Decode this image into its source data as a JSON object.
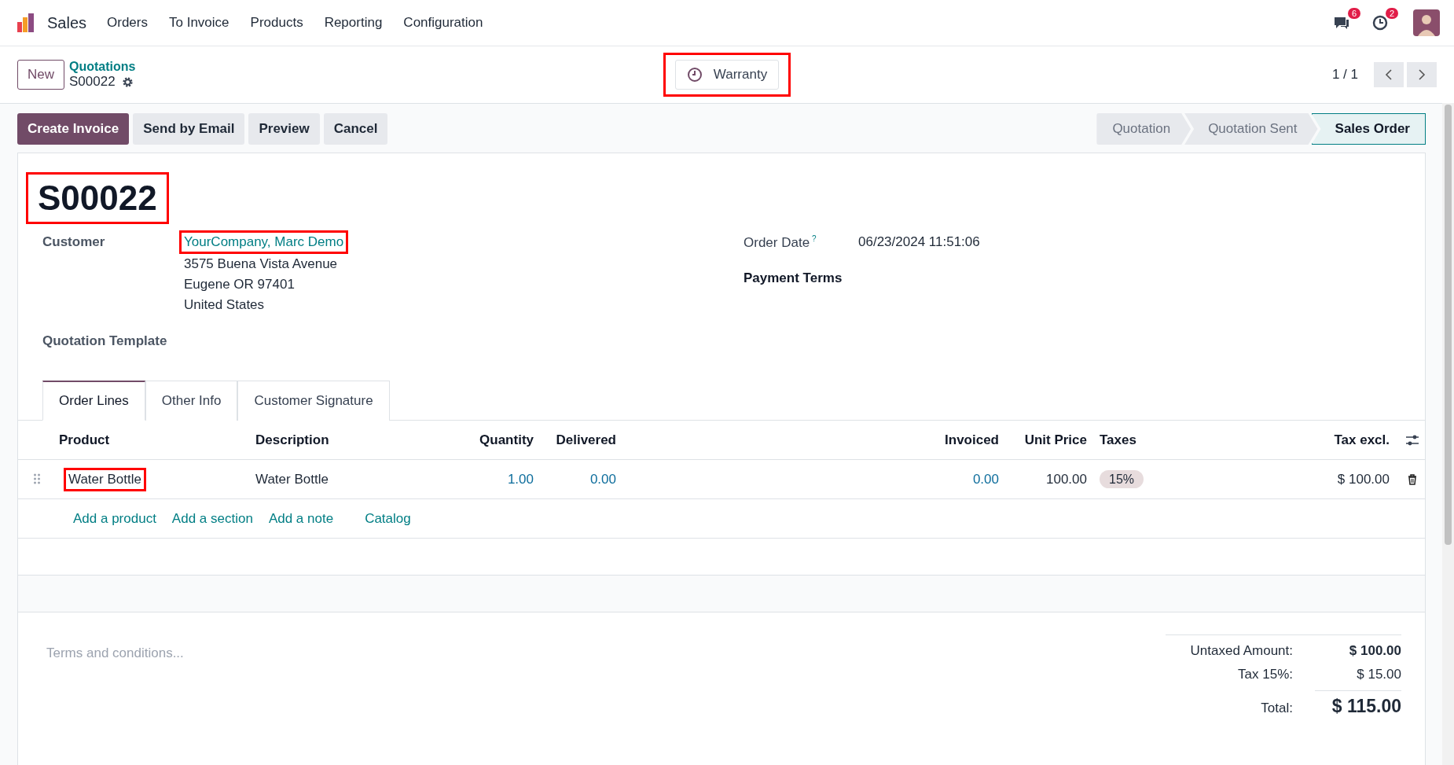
{
  "navbar": {
    "app": "Sales",
    "menu": [
      "Orders",
      "To Invoice",
      "Products",
      "Reporting",
      "Configuration"
    ],
    "messages_count": "6",
    "activities_count": "2"
  },
  "control_panel": {
    "new_button": "New",
    "breadcrumb": "Quotations",
    "record": "S00022",
    "smart_button": {
      "label": "Warranty",
      "highlighted": true
    },
    "pager": "1 / 1"
  },
  "actions": [
    {
      "label": "Create Invoice",
      "primary": true
    },
    {
      "label": "Send by Email",
      "primary": false
    },
    {
      "label": "Preview",
      "primary": false
    },
    {
      "label": "Cancel",
      "primary": false
    }
  ],
  "statusbar": [
    {
      "label": "Quotation",
      "selected": false
    },
    {
      "label": "Quotation Sent",
      "selected": false
    },
    {
      "label": "Sales Order",
      "selected": true
    }
  ],
  "title": {
    "text": "S00022",
    "highlighted": true
  },
  "fields_left": [
    {
      "label": "Customer",
      "value": "YourCompany, Marc Demo",
      "highlighted": true,
      "address": [
        "3575 Buena Vista Avenue",
        "Eugene OR 97401",
        "United States"
      ]
    },
    {
      "label": "Quotation Template"
    }
  ],
  "fields_right": [
    {
      "label": "Order Date",
      "help": "?",
      "value": "06/23/2024 11:51:06"
    },
    {
      "label": "Payment Terms"
    }
  ],
  "tabs": [
    {
      "label": "Order Lines",
      "selected": true
    },
    {
      "label": "Other Info",
      "selected": false
    },
    {
      "label": "Customer Signature",
      "selected": false
    }
  ],
  "table": {
    "columns": [
      {
        "label": "Product",
        "kind": "text"
      },
      {
        "label": "Description",
        "kind": "text"
      },
      {
        "label": "Quantity",
        "kind": "link-number"
      },
      {
        "label": "Delivered",
        "kind": "link-number"
      },
      {
        "label": "Invoiced",
        "kind": "link-number"
      },
      {
        "label": "Unit Price",
        "kind": "number"
      },
      {
        "label": "Taxes",
        "kind": "tag"
      },
      {
        "label": "Tax excl.",
        "kind": "number"
      }
    ],
    "rows": [
      {
        "cells": [
          "Water Bottle",
          "Water Bottle",
          "1.00",
          "0.00",
          "0.00",
          "100.00",
          "15%",
          "$ 100.00"
        ],
        "highlighted": true
      }
    ],
    "add_links": [
      "Add a product",
      "Add a section",
      "Add a note",
      "Catalog"
    ]
  },
  "notes": {
    "placeholder": "Terms and conditions..."
  },
  "totals": [
    {
      "label": "Untaxed Amount:",
      "value": "$ 100.00",
      "kind": "subtotal"
    },
    {
      "label": "Tax 15%:",
      "value": "$ 15.00",
      "kind": "tax"
    },
    {
      "label": "Total:",
      "value": "$ 115.00",
      "kind": "total"
    }
  ]
}
